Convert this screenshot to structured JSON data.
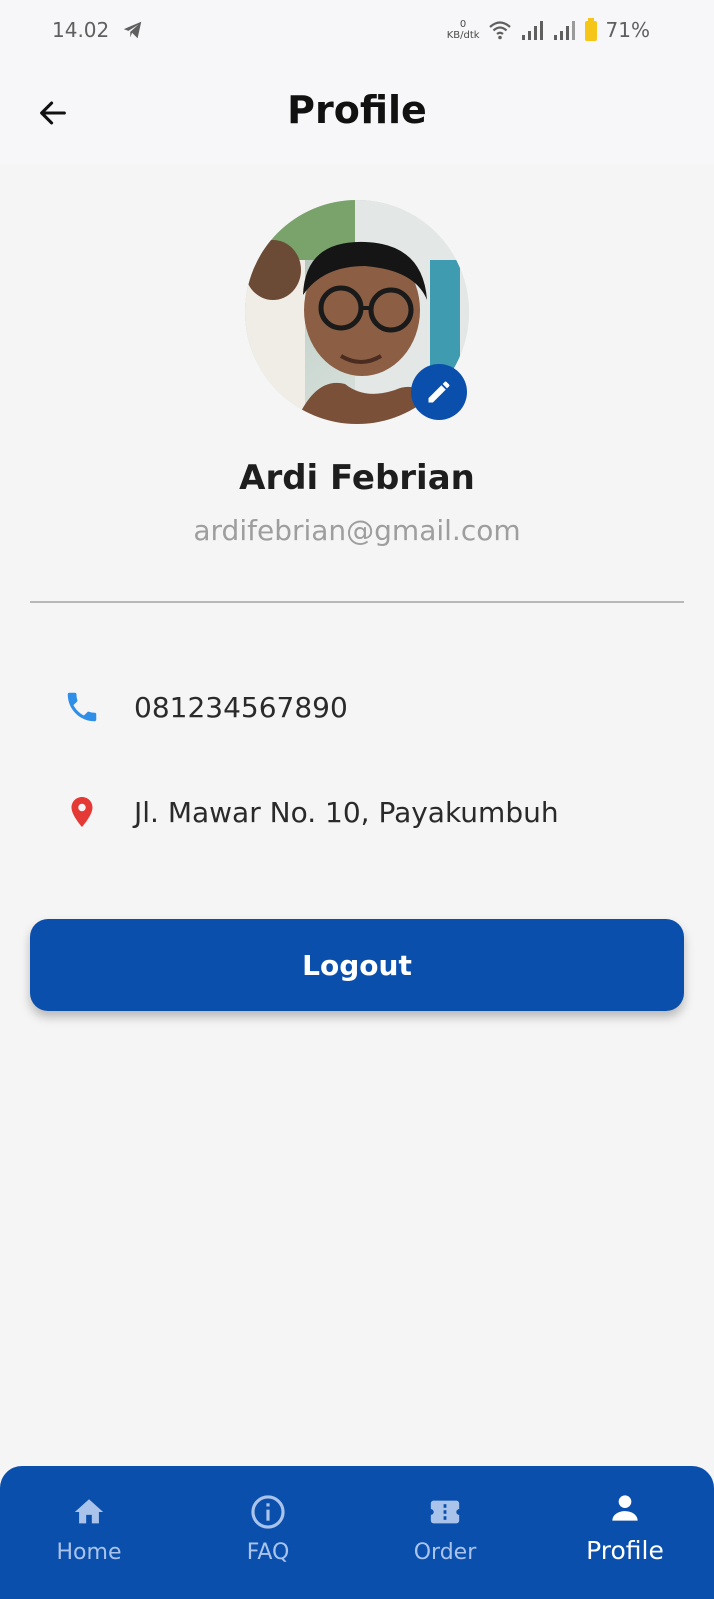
{
  "status_bar": {
    "time": "14.02",
    "net_speed_value": "0",
    "net_speed_unit": "KB/dtk",
    "battery": "71%"
  },
  "app_bar": {
    "title": "Profile"
  },
  "profile": {
    "name": "Ardi Febrian",
    "email": "ardifebrian@gmail.com",
    "phone": "081234567890",
    "address": "Jl. Mawar No. 10, Payakumbuh"
  },
  "actions": {
    "logout_label": "Logout"
  },
  "bottom_nav": {
    "items": [
      {
        "label": "Home",
        "icon": "home-icon",
        "active": false
      },
      {
        "label": "FAQ",
        "icon": "info-icon",
        "active": false
      },
      {
        "label": "Order",
        "icon": "ticket-icon",
        "active": false
      },
      {
        "label": "Profile",
        "icon": "person-icon",
        "active": true
      }
    ]
  },
  "colors": {
    "primary": "#0b4fad",
    "phone_icon": "#2f8fe8",
    "location_icon": "#e53935",
    "battery": "#f5c518"
  }
}
